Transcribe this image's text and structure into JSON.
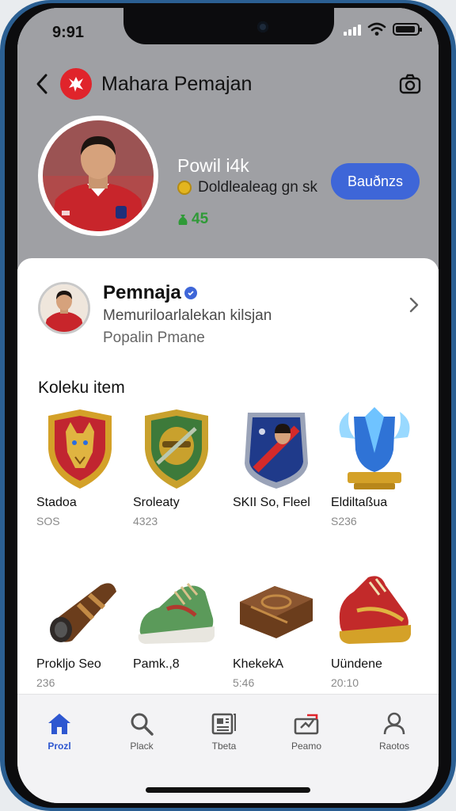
{
  "status_bar": {
    "time": "9:91"
  },
  "header": {
    "title": "Mahara Pemajan"
  },
  "profile": {
    "name": "Powil i4k",
    "subtitle": "Doldlealeag gn sk",
    "cash": "45",
    "action_label": "Bauðnzs"
  },
  "player_card": {
    "name": "Pemnaja",
    "description": "Memuriloarlalekan kilsjan",
    "subtitle": "Popalin Pmane"
  },
  "collection": {
    "title": "Koleku item",
    "items": [
      {
        "name": "Stadoa",
        "price": "SOS",
        "icon": "wolf-shield-icon"
      },
      {
        "name": "Sroleaty",
        "price": "4323",
        "icon": "helmet-shield-icon"
      },
      {
        "name": "SKII So, Fleel",
        "price": "",
        "icon": "player-card-icon"
      },
      {
        "name": "Eldiltaßua",
        "price": "S236",
        "icon": "crystal-trophy-icon"
      },
      {
        "name": "Prokljo Seo",
        "price": "236",
        "icon": "leather-tube-icon"
      },
      {
        "name": "Pamk.,8",
        "price": "",
        "icon": "green-sneaker-icon"
      },
      {
        "name": "KhekekA",
        "price": "5:46",
        "icon": "leather-wallet-icon"
      },
      {
        "name": "Uündene",
        "price": "20:10",
        "icon": "red-boot-icon"
      }
    ]
  },
  "tabs": [
    {
      "label": "Prozl",
      "icon": "home-icon",
      "active": true
    },
    {
      "label": "Plack",
      "icon": "search-icon",
      "active": false
    },
    {
      "label": "Tbeta",
      "icon": "news-icon",
      "active": false
    },
    {
      "label": "Peamo",
      "icon": "inbox-icon",
      "active": false
    },
    {
      "label": "Raotos",
      "icon": "profile-icon",
      "active": false
    }
  ],
  "colors": {
    "accent": "#3e66d8",
    "brand_red": "#e0242b",
    "cash_green": "#2f9a37",
    "frame_blue": "#2b5f92"
  }
}
